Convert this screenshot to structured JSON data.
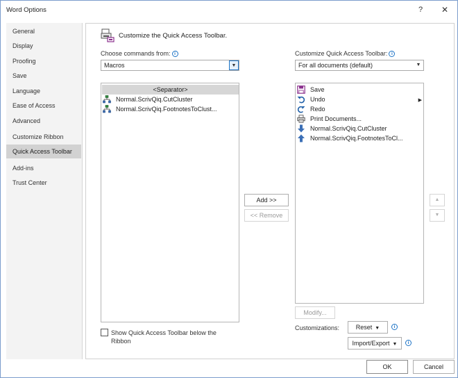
{
  "window": {
    "title": "Word Options",
    "help": "?",
    "close": "✕"
  },
  "nav": {
    "items": [
      {
        "label": "General"
      },
      {
        "label": "Display"
      },
      {
        "label": "Proofing"
      },
      {
        "label": "Save"
      },
      {
        "label": "Language"
      },
      {
        "label": "Ease of Access"
      },
      {
        "label": "Advanced"
      },
      {
        "label": "Customize Ribbon"
      },
      {
        "label": "Quick Access Toolbar",
        "selected": true
      },
      {
        "label": "Add-ins"
      },
      {
        "label": "Trust Center"
      }
    ]
  },
  "header": {
    "title": "Customize the Quick Access Toolbar."
  },
  "left": {
    "choose_label": "Choose commands from:",
    "choose_value": "Macros",
    "commands": [
      {
        "label": "<Separator>",
        "type": "separator"
      },
      {
        "label": "Normal.ScrivQiq.CutCluster",
        "icon": "macro-icon"
      },
      {
        "label": "Normal.ScrivQiq.FootnotesToClust...",
        "icon": "macro-icon"
      }
    ],
    "show_below_label": "Show Quick Access Toolbar below the Ribbon"
  },
  "middle": {
    "add_label": "Add >>",
    "remove_label": "<< Remove"
  },
  "right": {
    "customize_label": "Customize Quick Access Toolbar:",
    "customize_value": "For all documents (default)",
    "items": [
      {
        "label": "Save",
        "icon": "save-icon"
      },
      {
        "label": "Undo",
        "icon": "undo-icon",
        "has_submenu": true
      },
      {
        "label": "Redo",
        "icon": "redo-icon"
      },
      {
        "label": "Print Documents...",
        "icon": "print-icon"
      },
      {
        "label": "Normal.ScrivQiq.CutCluster",
        "icon": "arrow-down-icon"
      },
      {
        "label": "Normal.ScrivQiq.FootnotesToCl...",
        "icon": "arrow-up-icon"
      }
    ],
    "modify_label": "Modify...",
    "customizations_label": "Customizations:",
    "reset_label": "Reset",
    "import_export_label": "Import/Export"
  },
  "footer": {
    "ok_label": "OK",
    "cancel_label": "Cancel"
  },
  "colors": {
    "accent": "#1e74c6",
    "selected_nav": "#d2d2d2",
    "nav_bg": "#f3f3f3"
  }
}
